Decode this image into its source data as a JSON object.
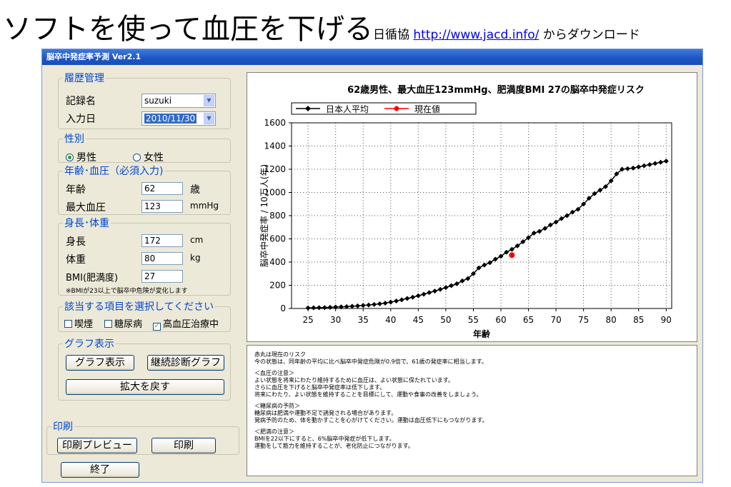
{
  "headline": {
    "main": "ソフトを使って血圧を下げる",
    "org": "日循協 ",
    "url": "http://www.jacd.info/",
    "suffix": " からダウンロード"
  },
  "window": {
    "title": "脳卒中発症率予測 Ver2.1"
  },
  "history": {
    "legend": "履歴管理",
    "record_label": "記録名",
    "record_value": "suzuki",
    "date_label": "入力日",
    "date_value": "2010/11/30"
  },
  "sex": {
    "legend": "性別",
    "male": "男性",
    "female": "女性",
    "selected": "male"
  },
  "age_bp": {
    "legend": "年齢･血圧（必須入力)",
    "age_label": "年齢",
    "age_value": "62",
    "age_unit": "歳",
    "sbp_label": "最大血圧",
    "sbp_value": "123",
    "sbp_unit": "mmHg"
  },
  "body": {
    "legend": "身長･体重",
    "height_label": "身長",
    "height_value": "172",
    "height_unit": "cm",
    "weight_label": "体重",
    "weight_value": "80",
    "weight_unit": "kg",
    "bmi_label": "BMI(肥満度)",
    "bmi_value": "27",
    "note": "※BMIが23以上で脳卒中危険が変化します"
  },
  "conditions": {
    "legend": "該当する項目を選択してください",
    "smoking": "喫煙",
    "diabetes": "糖尿病",
    "hypertension": "高血圧治療中"
  },
  "graph": {
    "legend": "グラフ表示",
    "show_button": "グラフ表示",
    "continuous_button": "継続診断グラフ",
    "restore_button": "拡大を戻す"
  },
  "print": {
    "legend": "印刷",
    "preview_button": "印刷プレビュー",
    "print_button": "印刷"
  },
  "exit_button": "終了",
  "chart_data": {
    "type": "line",
    "title": "62歳男性、最大血圧123mmHg、肥満度BMI 27の脳卒中発症リスク",
    "xlabel": "年齢",
    "ylabel": "脳卒中発症率 / 10万人(年)",
    "xlim": [
      22,
      91
    ],
    "ylim": [
      0,
      1600
    ],
    "x_ticks": [
      25,
      30,
      35,
      40,
      45,
      50,
      55,
      60,
      65,
      70,
      75,
      80,
      85,
      90
    ],
    "y_ticks": [
      0,
      200,
      400,
      600,
      800,
      1000,
      1200,
      1400,
      1600
    ],
    "grid": true,
    "legend_position": "top-left",
    "series": [
      {
        "name": "日本人平均",
        "color": "#000000",
        "marker": "diamond",
        "x": [
          25,
          26,
          27,
          28,
          29,
          30,
          31,
          32,
          33,
          34,
          35,
          36,
          37,
          38,
          39,
          40,
          41,
          42,
          43,
          44,
          45,
          46,
          47,
          48,
          49,
          50,
          51,
          52,
          53,
          54,
          55,
          56,
          57,
          58,
          59,
          60,
          61,
          62,
          63,
          64,
          65,
          66,
          67,
          68,
          69,
          70,
          71,
          72,
          73,
          74,
          75,
          76,
          77,
          78,
          79,
          80,
          81,
          82,
          83,
          84,
          85,
          86,
          87,
          88,
          89,
          90
        ],
        "y": [
          5,
          6,
          7,
          8,
          10,
          12,
          14,
          16,
          19,
          22,
          26,
          30,
          35,
          40,
          46,
          55,
          65,
          75,
          86,
          97,
          110,
          123,
          137,
          150,
          165,
          180,
          197,
          213,
          238,
          258,
          300,
          350,
          375,
          395,
          425,
          450,
          485,
          510,
          540,
          575,
          610,
          650,
          665,
          690,
          720,
          745,
          775,
          800,
          830,
          855,
          900,
          950,
          990,
          1020,
          1050,
          1100,
          1160,
          1200,
          1205,
          1210,
          1220,
          1230,
          1240,
          1250,
          1260,
          1270
        ]
      },
      {
        "name": "現在値",
        "color": "#ff0000",
        "marker": "circle",
        "x": [
          62
        ],
        "y": [
          460
        ]
      }
    ]
  },
  "advice": {
    "p1": [
      "赤丸は現在のリスク",
      "今の状態は、同年齢の平均に比べ脳卒中発症危険が0.9倍で、61歳の発症率に相当します。"
    ],
    "p2": [
      "＜血圧の注意＞",
      "よい状態を将来にわたり維持するために血圧は、よい状態に保たれています。",
      "さらに血圧を下げると脳卒中発症率は低下します。",
      "将来にわたり、よい状態を維持することを目標にして、運動や食事の改善をしましょう。"
    ],
    "p3": [
      "＜糖尿病の予防＞",
      "糖尿病は肥満や運動不足で誘発される場合があります。",
      "発病予防のため、体を動かすことを心がけてください。運動は血圧低下にもつながります。"
    ],
    "p4": [
      "＜肥満の注意＞",
      "BMIを22以下にすると、6%脳卒中発症が低下します。",
      "運動をして筋力を維持することが、老化防止につながります。"
    ]
  }
}
